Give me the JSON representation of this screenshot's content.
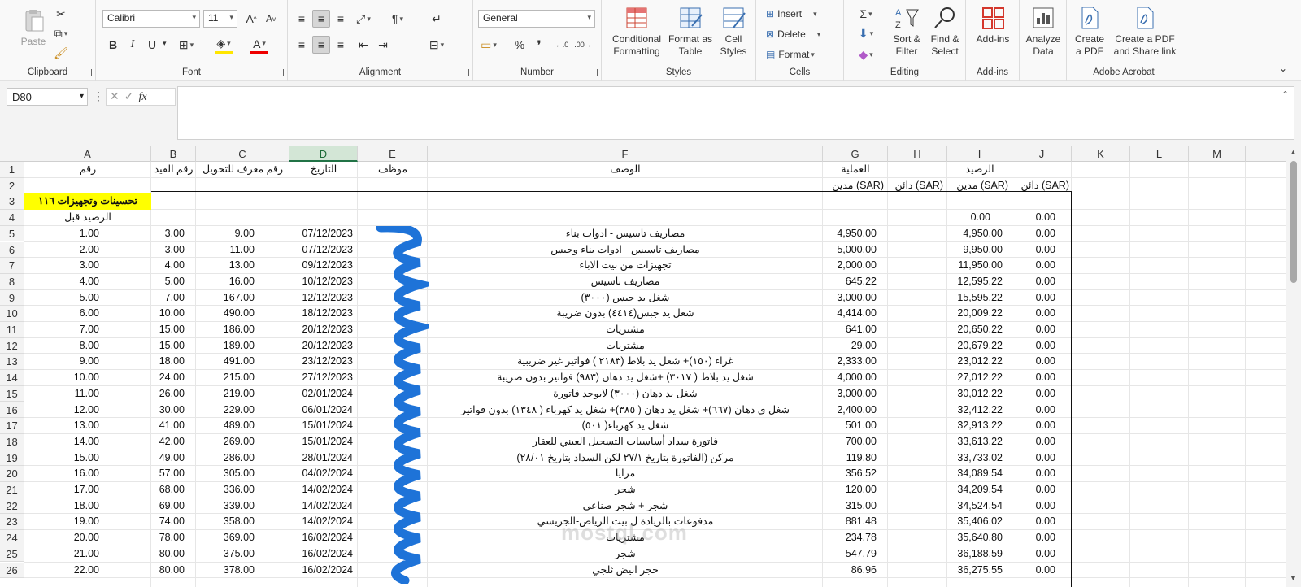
{
  "ribbon": {
    "clipboard": {
      "label": "Clipboard",
      "paste": "Paste"
    },
    "font": {
      "label": "Font",
      "name": "Calibri",
      "size": "11",
      "bold": "B",
      "italic": "I",
      "underline": "U"
    },
    "alignment": {
      "label": "Alignment"
    },
    "number": {
      "label": "Number",
      "format": "General"
    },
    "styles": {
      "label": "Styles",
      "conditional": "Conditional Formatting",
      "format_table": "Format as Table",
      "cell_styles": "Cell Styles"
    },
    "cells": {
      "label": "Cells",
      "insert": "Insert",
      "delete": "Delete",
      "format": "Format"
    },
    "editing": {
      "label": "Editing",
      "sort_filter": "Sort & Filter",
      "find_select": "Find & Select"
    },
    "addins": {
      "label": "Add-ins",
      "addins": "Add-ins"
    },
    "analyze": {
      "label": "Analyze Data"
    },
    "acrobat": {
      "label": "Adobe Acrobat",
      "create_pdf": "Create a PDF",
      "create_share": "Create a PDF and Share link"
    }
  },
  "formula_bar": {
    "name_box": "D80",
    "fx": "fx",
    "formula": ""
  },
  "columns": [
    "A",
    "B",
    "C",
    "D",
    "E",
    "F",
    "G",
    "H",
    "I",
    "J",
    "K",
    "L",
    "M"
  ],
  "active_column": "D",
  "rows": [
    "1",
    "2",
    "3",
    "4",
    "5",
    "6",
    "7",
    "8",
    "9",
    "10",
    "11",
    "12",
    "13",
    "14",
    "15",
    "16",
    "17",
    "18",
    "19",
    "20",
    "21",
    "22",
    "23",
    "24",
    "25",
    "26"
  ],
  "headers": {
    "a1": "رقم",
    "b1": "رقم القيد",
    "c1": "رقم معرف للتحويل",
    "d1": "التاريخ",
    "e1": "موظف",
    "f1": "الوصف",
    "g1": "العملية",
    "i1": "الرصيد",
    "g2": "مدين (SAR)",
    "h2": "دائن (SAR)",
    "i2": "مدين (SAR)",
    "j2": "دائن (SAR)"
  },
  "section_title": "تحسينات وتجهيزات ١١٦",
  "opening_label": "الرصيد قبل",
  "opening_balance": {
    "i": "0.00",
    "j": "0.00"
  },
  "data_rows": [
    {
      "a": "1.00",
      "b": "3.00",
      "c": "9.00",
      "d": "07/12/2023",
      "f": "مصاريف تاسيس - ادوات بناء",
      "g": "4,950.00",
      "i": "4,950.00",
      "j": "0.00"
    },
    {
      "a": "2.00",
      "b": "3.00",
      "c": "11.00",
      "d": "07/12/2023",
      "f": "مصاريف تاسيس - ادوات بناء وجبس",
      "g": "5,000.00",
      "i": "9,950.00",
      "j": "0.00"
    },
    {
      "a": "3.00",
      "b": "4.00",
      "c": "13.00",
      "d": "09/12/2023",
      "f": "تجهيزات من بيت الاباء",
      "g": "2,000.00",
      "i": "11,950.00",
      "j": "0.00"
    },
    {
      "a": "4.00",
      "b": "5.00",
      "c": "16.00",
      "d": "10/12/2023",
      "f": "مصاريف تاسيس",
      "g": "645.22",
      "i": "12,595.22",
      "j": "0.00"
    },
    {
      "a": "5.00",
      "b": "7.00",
      "c": "167.00",
      "d": "12/12/2023",
      "f": "شغل يد جبس (٣٠٠٠)",
      "g": "3,000.00",
      "i": "15,595.22",
      "j": "0.00"
    },
    {
      "a": "6.00",
      "b": "10.00",
      "c": "490.00",
      "d": "18/12/2023",
      "f": "شغل يد جبس(٤٤١٤) بدون ضريبة",
      "g": "4,414.00",
      "i": "20,009.22",
      "j": "0.00"
    },
    {
      "a": "7.00",
      "b": "15.00",
      "c": "186.00",
      "d": "20/12/2023",
      "f": "مشتريات",
      "g": "641.00",
      "i": "20,650.22",
      "j": "0.00"
    },
    {
      "a": "8.00",
      "b": "15.00",
      "c": "189.00",
      "d": "20/12/2023",
      "f": "مشتريات",
      "g": "29.00",
      "i": "20,679.22",
      "j": "0.00"
    },
    {
      "a": "9.00",
      "b": "18.00",
      "c": "491.00",
      "d": "23/12/2023",
      "f": "غراء (١٥٠)+ شغل يد بلاط (٢١٨٣ ) فواتير غير ضريبية",
      "g": "2,333.00",
      "i": "23,012.22",
      "j": "0.00"
    },
    {
      "a": "10.00",
      "b": "24.00",
      "c": "215.00",
      "d": "27/12/2023",
      "f": "شغل يد بلاط ( ٣٠١٧) +شغل يد دهان (٩٨٣) فواتير بدون ضريبة",
      "g": "4,000.00",
      "i": "27,012.22",
      "j": "0.00"
    },
    {
      "a": "11.00",
      "b": "26.00",
      "c": "219.00",
      "d": "02/01/2024",
      "f": "شغل يد دهان (٣٠٠٠) لايوجد فاتورة",
      "g": "3,000.00",
      "i": "30,012.22",
      "j": "0.00"
    },
    {
      "a": "12.00",
      "b": "30.00",
      "c": "229.00",
      "d": "06/01/2024",
      "f": "شغل ي دهان (٦٦٧)+ شغل يد دهان ( ٣٨٥)+ شغل يد كهرباء ( ١٣٤٨)  بدون فواتير",
      "g": "2,400.00",
      "i": "32,412.22",
      "j": "0.00"
    },
    {
      "a": "13.00",
      "b": "41.00",
      "c": "489.00",
      "d": "15/01/2024",
      "f": "شغل يد كهرباء( ٥٠١)",
      "g": "501.00",
      "i": "32,913.22",
      "j": "0.00"
    },
    {
      "a": "14.00",
      "b": "42.00",
      "c": "269.00",
      "d": "15/01/2024",
      "f": "فاتورة سداد أساسيات التسجيل العيني للعقار",
      "g": "700.00",
      "i": "33,613.22",
      "j": "0.00"
    },
    {
      "a": "15.00",
      "b": "49.00",
      "c": "286.00",
      "d": "28/01/2024",
      "f": "مركن (الفاتورة بتاريخ ٢٧/١ لكن السداد بتاريخ ٢٨/٠١)",
      "g": "119.80",
      "i": "33,733.02",
      "j": "0.00"
    },
    {
      "a": "16.00",
      "b": "57.00",
      "c": "305.00",
      "d": "04/02/2024",
      "f": "مرايا",
      "g": "356.52",
      "i": "34,089.54",
      "j": "0.00"
    },
    {
      "a": "17.00",
      "b": "68.00",
      "c": "336.00",
      "d": "14/02/2024",
      "f": "شجر",
      "g": "120.00",
      "i": "34,209.54",
      "j": "0.00"
    },
    {
      "a": "18.00",
      "b": "69.00",
      "c": "339.00",
      "d": "14/02/2024",
      "f": "شجر + شجر صناعي",
      "g": "315.00",
      "i": "34,524.54",
      "j": "0.00"
    },
    {
      "a": "19.00",
      "b": "74.00",
      "c": "358.00",
      "d": "14/02/2024",
      "f": "مدفوعات بالزيادة ل بيت الرياض-الجريسي",
      "g": "881.48",
      "i": "35,406.02",
      "j": "0.00"
    },
    {
      "a": "20.00",
      "b": "78.00",
      "c": "369.00",
      "d": "16/02/2024",
      "f": "مشتريات",
      "g": "234.78",
      "i": "35,640.80",
      "j": "0.00"
    },
    {
      "a": "21.00",
      "b": "80.00",
      "c": "375.00",
      "d": "16/02/2024",
      "f": "شجر",
      "g": "547.79",
      "i": "36,188.59",
      "j": "0.00"
    },
    {
      "a": "22.00",
      "b": "80.00",
      "c": "378.00",
      "d": "16/02/2024",
      "f": "حجر ابيض ثلجي",
      "g": "86.96",
      "i": "36,275.55",
      "j": "0.00"
    }
  ],
  "watermark": "mostql.com",
  "colors": {
    "excel_green": "#217346",
    "section_fill": "#ffff00"
  }
}
